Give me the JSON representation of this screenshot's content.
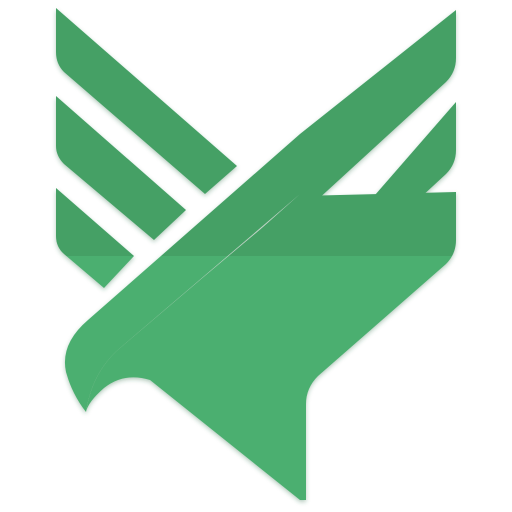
{
  "logo": {
    "icon": "eagle-wing-logo-icon",
    "colors": {
      "upper": "#45a065",
      "lower": "#4caf6f",
      "shadow": "#2f6b43",
      "background": "#ffffff"
    }
  }
}
